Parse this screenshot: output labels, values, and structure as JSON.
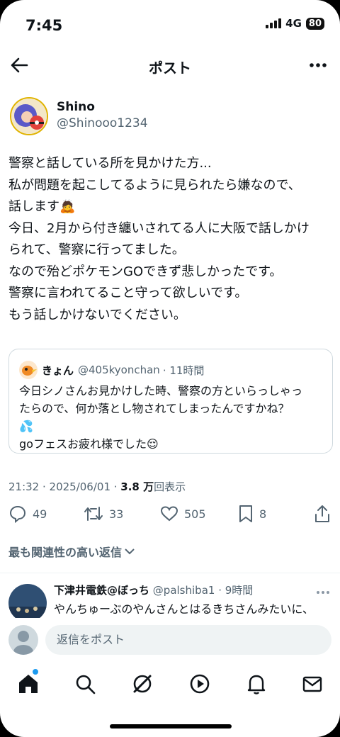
{
  "status": {
    "time": "7:45",
    "network": "4G",
    "battery": "80"
  },
  "header": {
    "title": "ポスト"
  },
  "author": {
    "display_name": "Shino",
    "handle": "@Shinooo1234"
  },
  "post": {
    "lines": [
      "警察と話している所を見かけた方...",
      "私が問題を起こしてるように見られたら嫌なので、",
      "話します🙇",
      "今日、2月から付き纏いされてる人に大阪で話しかけ",
      "られて、警察に行ってました。",
      "なので殆どポケモンGOできず悲しかったです。",
      "警察に言われてること守って欲しいです。",
      "もう話しかけないでください。"
    ]
  },
  "quote": {
    "name": "きょん",
    "handle": "@405kyonchan",
    "time": "· 11時間",
    "lines": [
      "今日シノさんお見かけした時、警察の方といらっしゃっ",
      "たらので、何か落とし物されてしまったんですかね？",
      "💦",
      "goフェスお疲れ様でした😌"
    ]
  },
  "meta": {
    "time": "21:32 · 2025/06/01 · ",
    "views_count": "3.8 万",
    "views_label": "回表示"
  },
  "actions": {
    "replies": "49",
    "reposts": "33",
    "likes": "505",
    "bookmarks": "8"
  },
  "sort": {
    "label": "最も関連性の高い返信"
  },
  "reply": {
    "name": "下津井電鉄@ぼっち",
    "handle": "@palshiba1",
    "time": "· 9時間",
    "text": "やんちゅーぶのやんさんとはるきちさんみたいに、"
  },
  "composer": {
    "placeholder": "返信をポスト"
  },
  "colors": {
    "accent": "#1d9bf0",
    "text": "#0f1419",
    "muted": "#536471"
  }
}
